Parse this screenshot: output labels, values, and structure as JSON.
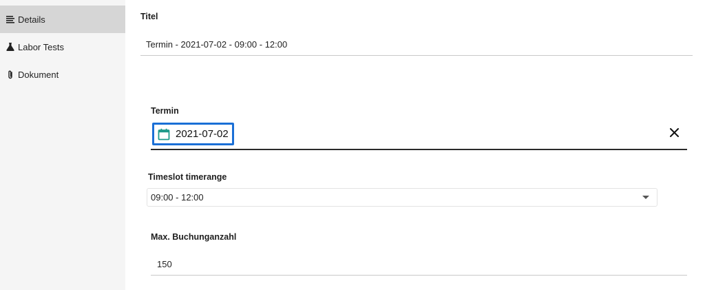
{
  "sidebar": {
    "items": [
      {
        "label": "Details",
        "icon": "list-icon",
        "active": true
      },
      {
        "label": "Labor Tests",
        "icon": "flask-icon",
        "active": false
      },
      {
        "label": "Dokument",
        "icon": "paperclip-icon",
        "active": false
      }
    ]
  },
  "form": {
    "titel": {
      "label": "Titel",
      "value": "Termin - 2021-07-02 - 09:00 - 12:00"
    },
    "termin": {
      "label": "Termin",
      "value": "2021-07-02"
    },
    "timeslot": {
      "label": "Timeslot timerange",
      "value": "09:00 - 12:00"
    },
    "max_buchung": {
      "label": "Max. Buchunganzahl",
      "value": "150"
    }
  },
  "colors": {
    "active_nav_bg": "#d6d6d6",
    "sidebar_bg": "#f5f5f5",
    "focus_border": "#1a6fd6",
    "calendar_icon": "#1f9a8a"
  }
}
